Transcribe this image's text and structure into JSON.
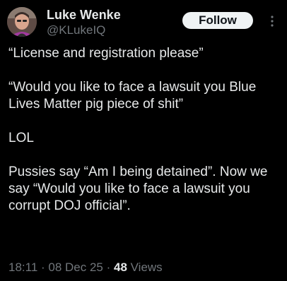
{
  "author": {
    "name": "Luke Wenke",
    "handle": "@KLukeIQ",
    "avatar_icon": "user-avatar-photo"
  },
  "follow_button": {
    "label": "Follow"
  },
  "more_icon": "more-vertical-icon",
  "tweet": {
    "paragraphs": [
      "“License and registration please”",
      "“Would you like to face a lawsuit you Blue Lives Matter pig piece of shit”",
      "LOL",
      "Pussies say “Am I being detained”. Now we say “Would you like to face a lawsuit you corrupt DOJ official”."
    ]
  },
  "meta": {
    "time": "18:11",
    "separator": " · ",
    "date": "08 Dec 25",
    "views_count": "48",
    "views_label": " Views"
  },
  "colors": {
    "background": "#000000",
    "text_primary": "#e7e9ea",
    "text_secondary": "#71767b",
    "button_bg": "#eff3f4",
    "button_text": "#0f1419"
  }
}
